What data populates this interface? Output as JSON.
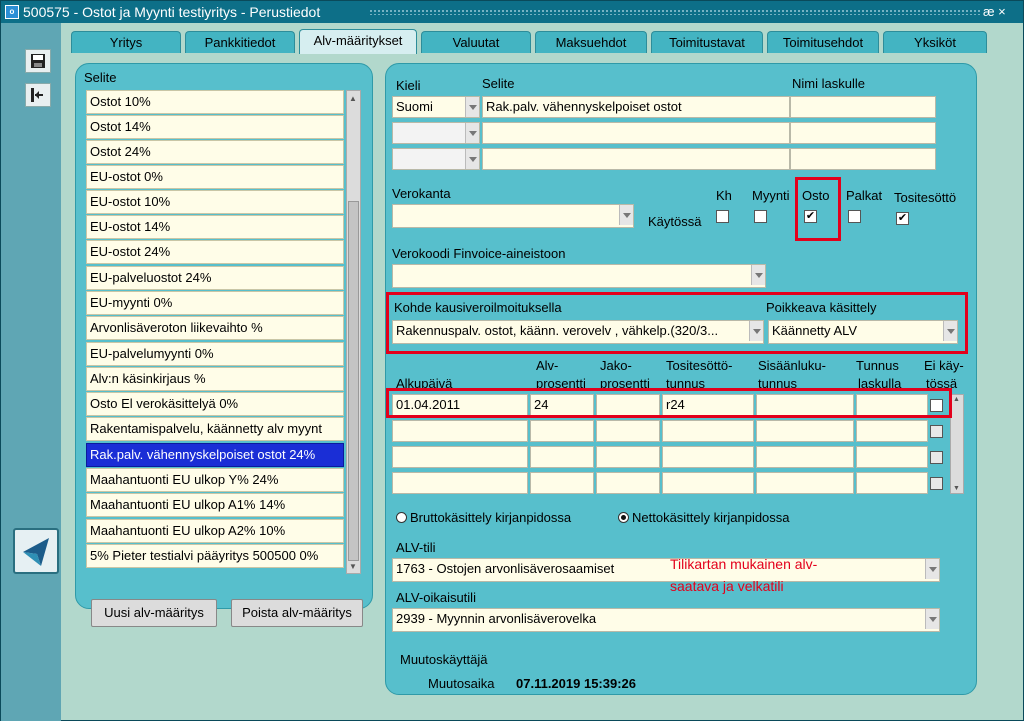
{
  "window": {
    "title": "500575 - Ostot ja Myynti testiyritys - Perustiedot",
    "ctrl_icon": "æ ×"
  },
  "toolbar": {
    "save_icon": "save-icon",
    "exit_icon": "exit-icon"
  },
  "tabs": [
    "Yritys",
    "Pankkitiedot",
    "Alv-määritykset",
    "Valuutat",
    "Maksuehdot",
    "Toimitustavat",
    "Toimitusehdot",
    "Yksiköt"
  ],
  "active_tab": "Alv-määritykset",
  "list": {
    "header": "Selite",
    "items": [
      "Ostot 10%",
      "Ostot 14%",
      "Ostot 24%",
      "EU-ostot 0%",
      "EU-ostot 10%",
      "EU-ostot 14%",
      "EU-ostot 24%",
      "EU-palveluostot 24%",
      "EU-myynti 0%",
      "Arvonlisäveroton liikevaihto %",
      "EU-palvelumyynti 0%",
      "Alv:n käsinkirjaus %",
      "Osto El verokäsittelyä 0%",
      "Rakentamispalvelu, käännetty alv myynt",
      "Rak.palv. vähennyskelpoiset ostot 24%",
      "Maahantuonti EU ulkop Y% 24%",
      "Maahantuonti EU ulkop A1% 14%",
      "Maahantuonti EU ulkop A2% 10%",
      "5% Pieter testialvi pääyritys 500500 0%"
    ],
    "selected_index": 14,
    "new_button": "Uusi alv-määritys",
    "delete_button": "Poista alv-määritys"
  },
  "detail": {
    "kieli_label": "Kieli",
    "selite_label": "Selite",
    "nimi_label": "Nimi laskulle",
    "rows": [
      {
        "kieli": "Suomi",
        "selite": "Rak.palv. vähennyskelpoiset ostot",
        "nimi": ""
      },
      {
        "kieli": "",
        "selite": "",
        "nimi": ""
      },
      {
        "kieli": "",
        "selite": "",
        "nimi": ""
      }
    ],
    "verokanta_label": "Verokanta",
    "verokanta_value": "",
    "kaytossa_label": "Käytössä",
    "usage": [
      {
        "label": "Kh",
        "checked": false
      },
      {
        "label": "Myynti",
        "checked": false
      },
      {
        "label": "Osto",
        "checked": true
      },
      {
        "label": "Palkat",
        "checked": false
      },
      {
        "label": "Tositesöttö",
        "checked": true
      }
    ],
    "finvoice_label": "Verokoodi Finvoice-aineistoon",
    "finvoice_value": "",
    "kohde_label": "Kohde kausiveroilmoituksella",
    "kohde_value": "Rakennuspalv. ostot, käänn. verovelv , vähkelp.(320/3...",
    "poikkeava_label": "Poikkeava käsittely",
    "poikkeava_value": "Käännetty ALV",
    "grid_headers": {
      "alkupaiva": "Alkupäivä",
      "alv1": "Alv-",
      "alv2": "prosentti",
      "jako1": "Jako-",
      "jako2": "prosentti",
      "tos1": "Tositesöttö-",
      "tos2": "tunnus",
      "sis1": "Sisäänluku-",
      "sis2": "tunnus",
      "tun1": "Tunnus",
      "tun2": "laskulla",
      "ei1": "Ei käy-",
      "ei2": "tössä"
    },
    "grid_rows": [
      {
        "alkupaiva": "01.04.2011",
        "alv": "24",
        "jako": "",
        "tosite": "r24",
        "sisaan": "",
        "tunnus": "",
        "ei": false
      },
      {
        "alkupaiva": "",
        "alv": "",
        "jako": "",
        "tosite": "",
        "sisaan": "",
        "tunnus": "",
        "ei": false
      },
      {
        "alkupaiva": "",
        "alv": "",
        "jako": "",
        "tosite": "",
        "sisaan": "",
        "tunnus": "",
        "ei": false
      },
      {
        "alkupaiva": "",
        "alv": "",
        "jako": "",
        "tosite": "",
        "sisaan": "",
        "tunnus": "",
        "ei": false
      }
    ],
    "radio_brutto": "Bruttokäsittely kirjanpidossa",
    "radio_netto": "Nettokäsittely kirjanpidossa",
    "radio_selected": "netto",
    "alv_tili_label": "ALV-tili",
    "alv_tili_value": "1763 - Ostojen arvonlisäverosaamiset",
    "note_line1": "Tilikartan mukainen alv-",
    "note_line2": "saatava ja velkatili",
    "alv_oikaisu_label": "ALV-oikaisutili",
    "alv_oikaisu_value": "2939 - Myynnin arvonlisäverovelka",
    "muutoskayttaja_label": "Muutoskäyttäjä",
    "muutosaika_label": "Muutosaika",
    "muutosaika_value": "07.11.2019 15:39:26"
  },
  "colors": {
    "accent": "#57bfcc",
    "highlight": "#e3001b",
    "selected": "#1a2ed6"
  }
}
